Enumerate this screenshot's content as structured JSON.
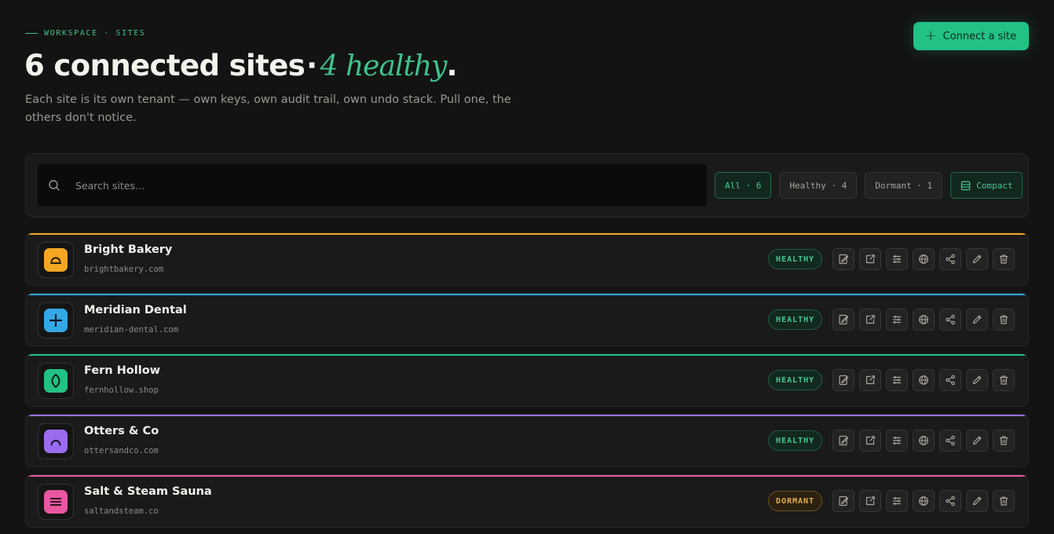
{
  "header": {
    "eyebrow": "WORKSPACE · SITES",
    "title_count": "6 connected sites",
    "title_sep": "·",
    "title_healthy": "4 healthy",
    "title_end": ".",
    "subtitle": "Each site is its own tenant — own keys, own audit trail, own undo stack. Pull one, the others don't notice.",
    "connect_label": "Connect a site"
  },
  "toolbar": {
    "search_placeholder": "Search sites...",
    "filters": [
      {
        "label": "All · 6",
        "active": true
      },
      {
        "label": "Healthy · 4",
        "active": false
      },
      {
        "label": "Dormant · 1",
        "active": false
      }
    ],
    "compact_label": "Compact"
  },
  "sites": [
    {
      "name": "Bright Bakery",
      "domain": "brightbakery.com",
      "status": "HEALTHY",
      "color": "#f5a623",
      "glyph": "dome"
    },
    {
      "name": "Meridian Dental",
      "domain": "meridian-dental.com",
      "status": "HEALTHY",
      "color": "#33a8e6",
      "glyph": "cross"
    },
    {
      "name": "Fern Hollow",
      "domain": "fernhollow.shop",
      "status": "HEALTHY",
      "color": "#22c184",
      "glyph": "leaf"
    },
    {
      "name": "Otters & Co",
      "domain": "ottersandco.com",
      "status": "HEALTHY",
      "color": "#9a6cf0",
      "glyph": "arch"
    },
    {
      "name": "Salt & Steam Sauna",
      "domain": "saltandsteam.co",
      "status": "DORMANT",
      "color": "#e957a0",
      "glyph": "lines"
    }
  ],
  "row_actions": [
    "edit-content-icon",
    "open-external-icon",
    "settings-sliders-icon",
    "globe-icon",
    "share-icon",
    "pencil-icon",
    "trash-icon"
  ]
}
